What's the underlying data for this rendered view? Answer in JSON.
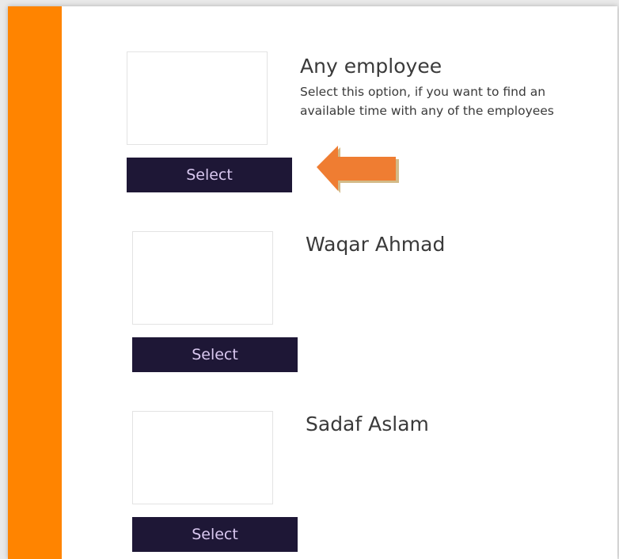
{
  "employees": [
    {
      "name": "Any employee",
      "description": "Select this option, if you want to find an available time with any of the employees",
      "button_label": "Select"
    },
    {
      "name": "Waqar Ahmad",
      "description": "",
      "button_label": "Select"
    },
    {
      "name": "Sadaf Aslam",
      "description": "",
      "button_label": "Select"
    }
  ],
  "colors": {
    "accent_bar": "#ff8400",
    "button_bg": "#1e1736",
    "button_text": "#d9c8f0",
    "arrow": "#ef7d32"
  },
  "icons": {
    "pointer": "arrow-left-icon"
  }
}
